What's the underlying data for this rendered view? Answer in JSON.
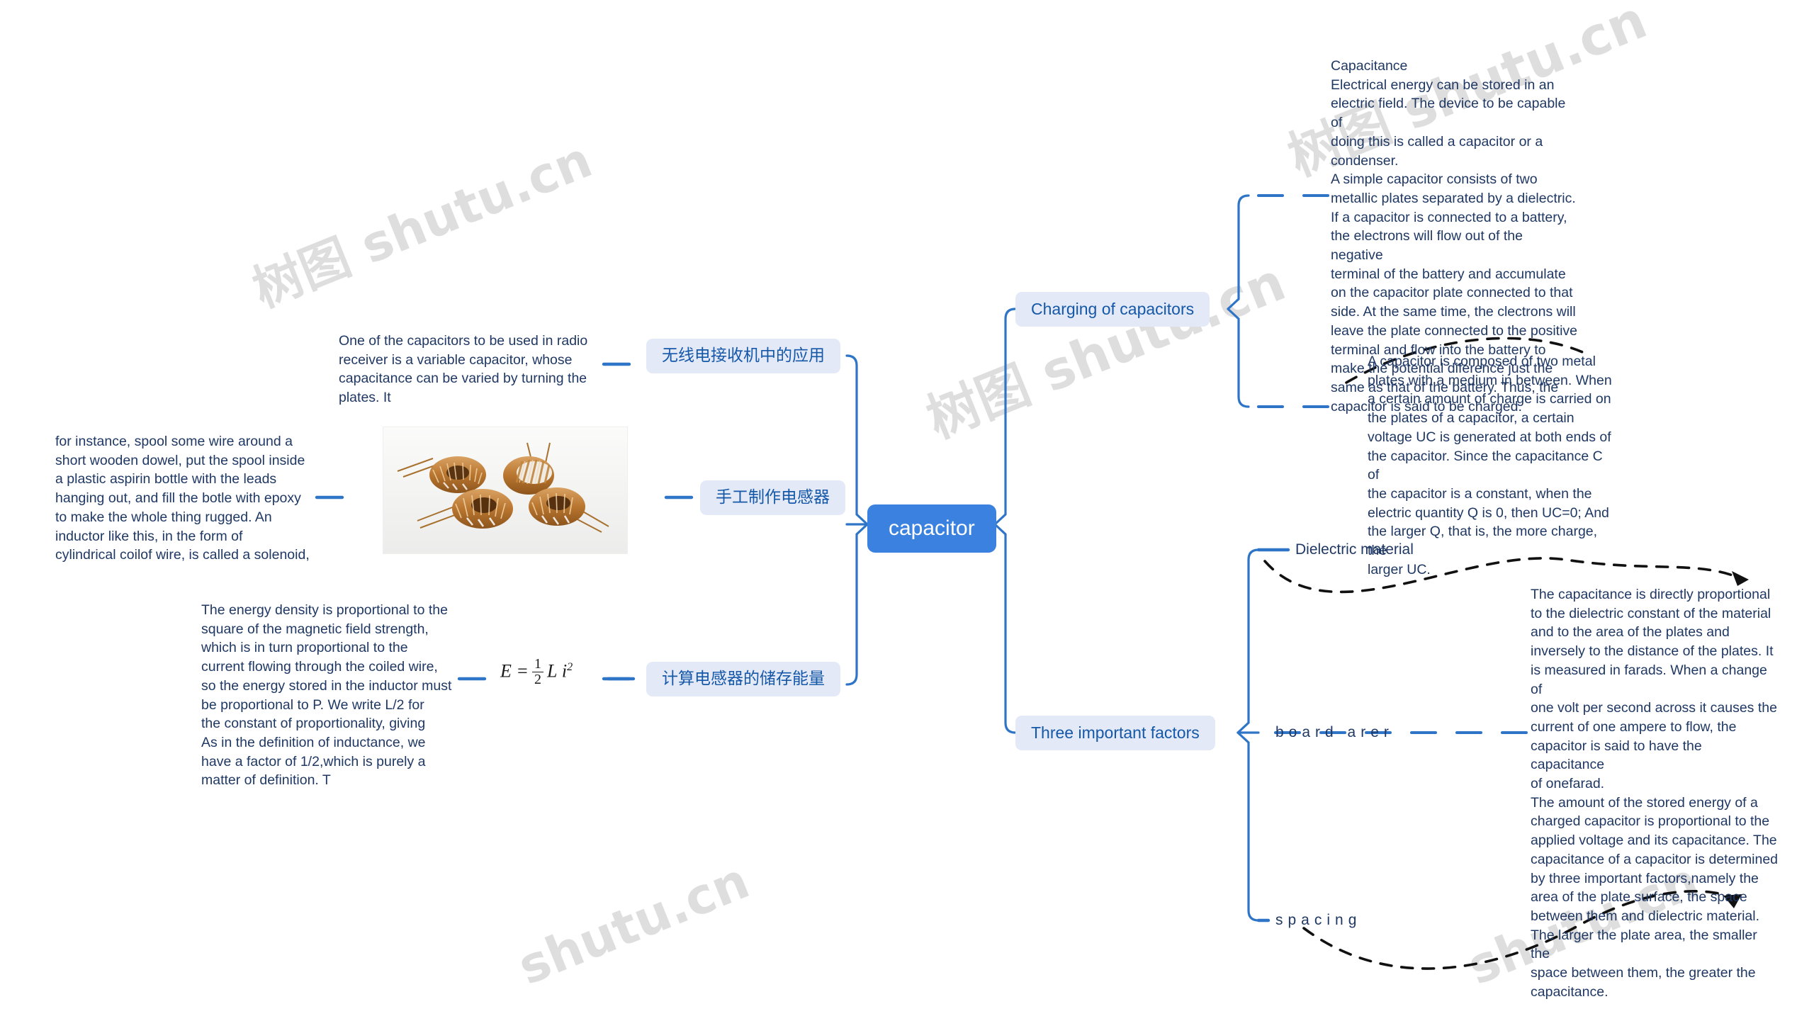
{
  "root": {
    "label": "capacitor"
  },
  "branches": {
    "right": [
      {
        "label": "Charging of capacitors"
      },
      {
        "label": "Three important factors"
      }
    ],
    "left": [
      {
        "label": "无线电接收机中的应用"
      },
      {
        "label": "手工制作电感器"
      },
      {
        "label": "计算电感器的储存能量"
      }
    ]
  },
  "sub_labels": {
    "dielectric_material": "Dielectric material",
    "board_arer": "board arer",
    "spacing": "spacing"
  },
  "texts": {
    "capacitance_note": "Capacitance\nElectrical energy can be stored in an\nelectric field. The device to be capable of\ndoing this is called a capacitor or a\ncondenser.\nA simple capacitor consists of two\nmetallic plates separated by a dielectric.\nIf a capacitor is connected to a battery,\nthe electrons will flow out of the negative\n terminal of the battery and accumulate\non the capacitor plate connected to that\nside. At the same time, the clectrons will\nleave the plate connected to the positive\nterminal and flow into the battery to\nmake the potential diference just the\nsame as that of the battery. Thus, the\ncapacitor is said to be charged.",
    "composition_note": "A capacitor is composed of two metal\nplates with a medium in between. When\na certain amount of charge is carried on\nthe plates of a capacitor, a certain\nvoltage UC is generated at both ends of\nthe capacitor. Since the capacitance C of\nthe capacitor is a constant, when the\nelectric quantity Q is 0, then UC=0; And\nthe larger Q, that is, the more charge, the\n larger UC.",
    "factors_note": " The capacitance is directly proportional\nto the dielectric constant of the material\nand to the area of the plates and\ninversely to the distance of the plates. It\nis measured in farads. When a change of\none volt per second across it causes the\ncurrent of one ampere to flow, the\ncapacitor is said to have the capacitance\nof onefarad.\nThe amount of the stored energy of a\ncharged capacitor is proportional to the\napplied voltage and its capacitance. The\ncapacitance of a capacitor is determined\nby three important factors,namely the\narea of the plate surface, the space\nbetween them and dielectric material.\nThe larger the plate area, the smaller the\nspace between them, the greater the\ncapacitance.",
    "radio_note": "One of the capacitors to be used in radio\nreceiver is a variable capacitor, whose\ncapacitance can be varied by turning the\nplates. It",
    "solenoid_note": " for instance, spool some wire around a\nshort wooden dowel, put the spool inside\n a plastic aspirin bottle with the leads\nhanging out, and fill the botle with epoxy\n to make the whole thing rugged. An\ninductor like this, in the form of\ncylindrical coilof wire, is called a solenoid,",
    "energy_note": "The energy density is proportional to the\nsquare of the magnetic field strength,\nwhich is in turn proportional to the\ncurrent flowing through the coiled wire,\nso the energy stored in the inductor must\n be proportional to P. We write L/2 for\nthe constant of proportionality, giving\nAs in the definition of inductance, we\nhave a factor of 1/2,which is purely a\nmatter of definition. T"
  },
  "formula": {
    "lhs": "E =",
    "numerator": "1",
    "denominator": "2",
    "rhs_l": "L",
    "rhs_i": "i",
    "rhs_exp": "2",
    "plain": "E = 1/2 L i²"
  },
  "image": {
    "alt": "toroidal-inductors-photo"
  },
  "watermarks": [
    {
      "text": "树图 shutu.cn"
    },
    {
      "text": "树图 shutu.cn"
    },
    {
      "text": "树图 shutu.cn"
    },
    {
      "text": "shutu.cn"
    },
    {
      "text": "shutu.cn"
    }
  ],
  "colors": {
    "root_bg": "#3b82e0",
    "node_bg": "#e4e9f7",
    "node_text": "#1558a8",
    "body_text": "#1f3864",
    "link": "#2e75c8",
    "dashed": "#111111"
  }
}
